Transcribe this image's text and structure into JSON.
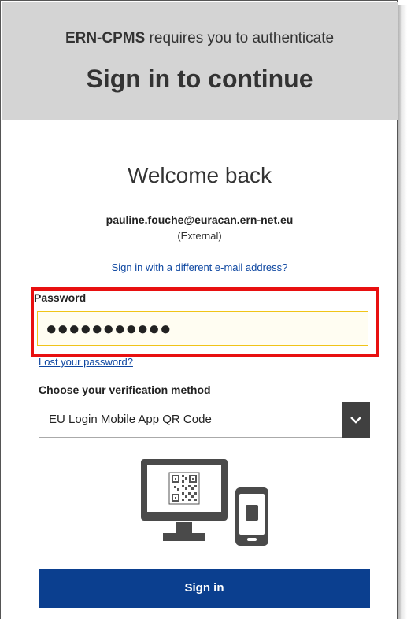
{
  "header": {
    "app_name": "ERN-CPMS",
    "sub_text": " requires you to authenticate",
    "title": "Sign in to continue"
  },
  "login": {
    "welcome": "Welcome back",
    "email": "pauline.fouche@euracan.ern-net.eu",
    "account_type": "(External)",
    "different_email_link": "Sign in with a different e-mail address?",
    "password_label": "Password",
    "password_masked": "●●●●●●●●●●●",
    "lost_password_link": "Lost your password?",
    "verification_label": "Choose your verification method",
    "verification_selected": "EU Login Mobile App QR Code",
    "sign_in_button": "Sign in"
  },
  "icons": {
    "dropdown": "chevron-down-icon",
    "illustration": "desktop-qr-phone-icon"
  },
  "colors": {
    "header_bg": "#d4d4d4",
    "primary": "#0b3f8f",
    "link": "#0e47a1",
    "highlight": "#e81010",
    "input_focus": "#f0c419"
  }
}
